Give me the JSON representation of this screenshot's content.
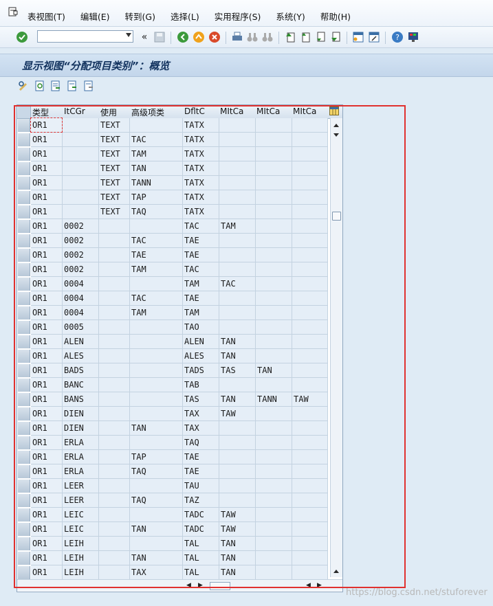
{
  "menubar": {
    "items": [
      "表视图(T)",
      "编辑(E)",
      "转到(G)",
      "选择(L)",
      "实用程序(S)",
      "系统(Y)",
      "帮助(H)"
    ]
  },
  "toolbar": {
    "command_value": "",
    "history_label": "«"
  },
  "title": "显示视图“分配项目类别”：概览",
  "table": {
    "columns": [
      "类型",
      "ItCGr",
      "使用",
      "高级项类",
      "DfltC",
      "MItCa",
      "MItCa",
      "MItCa"
    ],
    "rows": [
      [
        "OR1",
        "",
        "TEXT",
        "",
        "TATX",
        "",
        "",
        ""
      ],
      [
        "OR1",
        "",
        "TEXT",
        "TAC",
        "TATX",
        "",
        "",
        ""
      ],
      [
        "OR1",
        "",
        "TEXT",
        "TAM",
        "TATX",
        "",
        "",
        ""
      ],
      [
        "OR1",
        "",
        "TEXT",
        "TAN",
        "TATX",
        "",
        "",
        ""
      ],
      [
        "OR1",
        "",
        "TEXT",
        "TANN",
        "TATX",
        "",
        "",
        ""
      ],
      [
        "OR1",
        "",
        "TEXT",
        "TAP",
        "TATX",
        "",
        "",
        ""
      ],
      [
        "OR1",
        "",
        "TEXT",
        "TAQ",
        "TATX",
        "",
        "",
        ""
      ],
      [
        "OR1",
        "0002",
        "",
        "",
        "TAC",
        "TAM",
        "",
        ""
      ],
      [
        "OR1",
        "0002",
        "",
        "TAC",
        "TAE",
        "",
        "",
        ""
      ],
      [
        "OR1",
        "0002",
        "",
        "TAE",
        "TAE",
        "",
        "",
        ""
      ],
      [
        "OR1",
        "0002",
        "",
        "TAM",
        "TAC",
        "",
        "",
        ""
      ],
      [
        "OR1",
        "0004",
        "",
        "",
        "TAM",
        "TAC",
        "",
        ""
      ],
      [
        "OR1",
        "0004",
        "",
        "TAC",
        "TAE",
        "",
        "",
        ""
      ],
      [
        "OR1",
        "0004",
        "",
        "TAM",
        "TAM",
        "",
        "",
        ""
      ],
      [
        "OR1",
        "0005",
        "",
        "",
        "TAO",
        "",
        "",
        ""
      ],
      [
        "OR1",
        "ALEN",
        "",
        "",
        "ALEN",
        "TAN",
        "",
        ""
      ],
      [
        "OR1",
        "ALES",
        "",
        "",
        "ALES",
        "TAN",
        "",
        ""
      ],
      [
        "OR1",
        "BADS",
        "",
        "",
        "TADS",
        "TAS",
        "TAN",
        ""
      ],
      [
        "OR1",
        "BANC",
        "",
        "",
        "TAB",
        "",
        "",
        ""
      ],
      [
        "OR1",
        "BANS",
        "",
        "",
        "TAS",
        "TAN",
        "TANN",
        "TAW"
      ],
      [
        "OR1",
        "DIEN",
        "",
        "",
        "TAX",
        "TAW",
        "",
        ""
      ],
      [
        "OR1",
        "DIEN",
        "",
        "TAN",
        "TAX",
        "",
        "",
        ""
      ],
      [
        "OR1",
        "ERLA",
        "",
        "",
        "TAQ",
        "",
        "",
        ""
      ],
      [
        "OR1",
        "ERLA",
        "",
        "TAP",
        "TAE",
        "",
        "",
        ""
      ],
      [
        "OR1",
        "ERLA",
        "",
        "TAQ",
        "TAE",
        "",
        "",
        ""
      ],
      [
        "OR1",
        "LEER",
        "",
        "",
        "TAU",
        "",
        "",
        ""
      ],
      [
        "OR1",
        "LEER",
        "",
        "TAQ",
        "TAZ",
        "",
        "",
        ""
      ],
      [
        "OR1",
        "LEIC",
        "",
        "",
        "TADC",
        "TAW",
        "",
        ""
      ],
      [
        "OR1",
        "LEIC",
        "",
        "TAN",
        "TADC",
        "TAW",
        "",
        ""
      ],
      [
        "OR1",
        "LEIH",
        "",
        "",
        "TAL",
        "TAN",
        "",
        ""
      ],
      [
        "OR1",
        "LEIH",
        "",
        "TAN",
        "TAL",
        "TAN",
        "",
        ""
      ],
      [
        "OR1",
        "LEIH",
        "",
        "TAX",
        "TAL",
        "TAN",
        "",
        ""
      ]
    ]
  },
  "watermark": "https://blog.csdn.net/stuforever"
}
